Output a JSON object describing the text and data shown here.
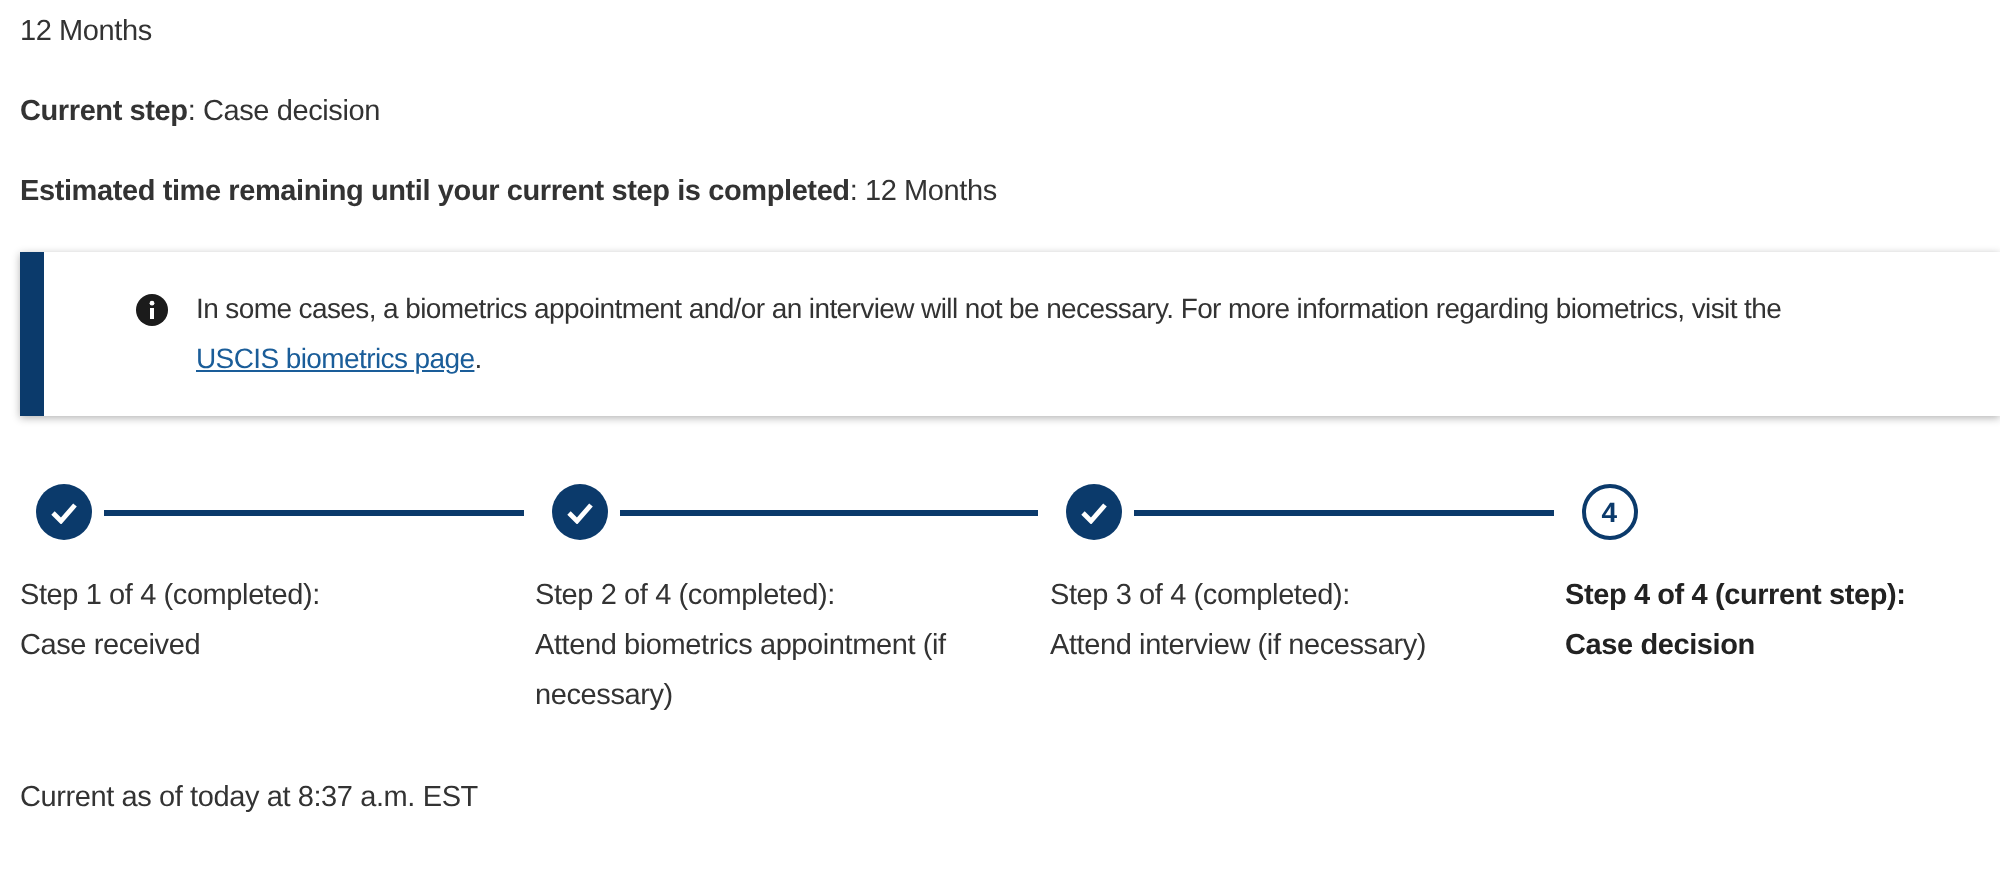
{
  "processing_time": "12 Months",
  "current_step": "**Current step**: Case decision",
  "time_remaining": "**Estimated time remaining until your current step is completed**: 12 Months",
  "alert": {
    "text": "In some cases, a biometrics appointment and/or an interview will not be necessary. For more information regarding biometrics, visit the ",
    "link": "USCIS biometrics page",
    "after": "."
  },
  "steps": [
    {
      "kind": "done",
      "heading": "Step 1 of 4 (completed):",
      "label": "Case received"
    },
    {
      "kind": "done",
      "heading": "Step 2 of 4 (completed):",
      "label": "Attend biometrics appointment (if necessary)"
    },
    {
      "kind": "done",
      "heading": "Step 3 of 4 (completed):",
      "label": "Attend interview (if necessary)"
    },
    {
      "kind": "current",
      "number": "4",
      "heading": "Step 4 of 4 (current step):",
      "label": "Case decision"
    }
  ],
  "updated": "Current as of today at 8:37 a.m. EST"
}
